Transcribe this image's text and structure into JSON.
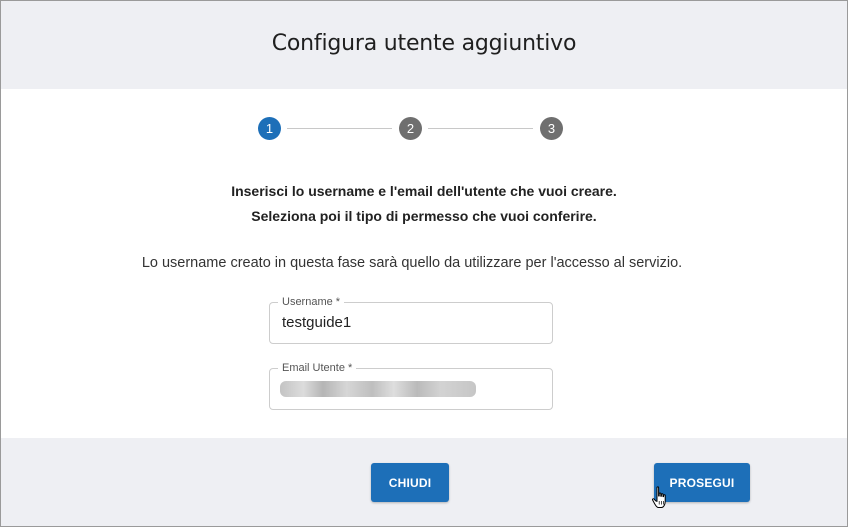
{
  "dialog": {
    "title": "Configura utente aggiuntivo"
  },
  "stepper": {
    "steps": [
      {
        "number": "1",
        "state": "active"
      },
      {
        "number": "2",
        "state": "inactive"
      },
      {
        "number": "3",
        "state": "inactive"
      }
    ],
    "colors": {
      "active": "#1d6fb8",
      "inactive": "#6f6f6f"
    }
  },
  "instructions": {
    "line1": "Inserisci lo username e l'email dell'utente che vuoi creare.",
    "line2": "Seleziona poi il tipo di permesso che vuoi conferire."
  },
  "note": "Lo username creato in questa fase sarà quello da utilizzare per l'accesso al servizio.",
  "form": {
    "username": {
      "label": "Username *",
      "value": "testguide1"
    },
    "email": {
      "label": "Email Utente *",
      "value": "",
      "obscured": true
    }
  },
  "footer": {
    "close_label": "CHIUDI",
    "continue_label": "PROSEGUI"
  },
  "theme": {
    "accent": "#1d6fb8",
    "header_bg": "#eeeff3"
  },
  "cursor": {
    "icon": "hand-pointer-icon",
    "target": "continue-button"
  }
}
